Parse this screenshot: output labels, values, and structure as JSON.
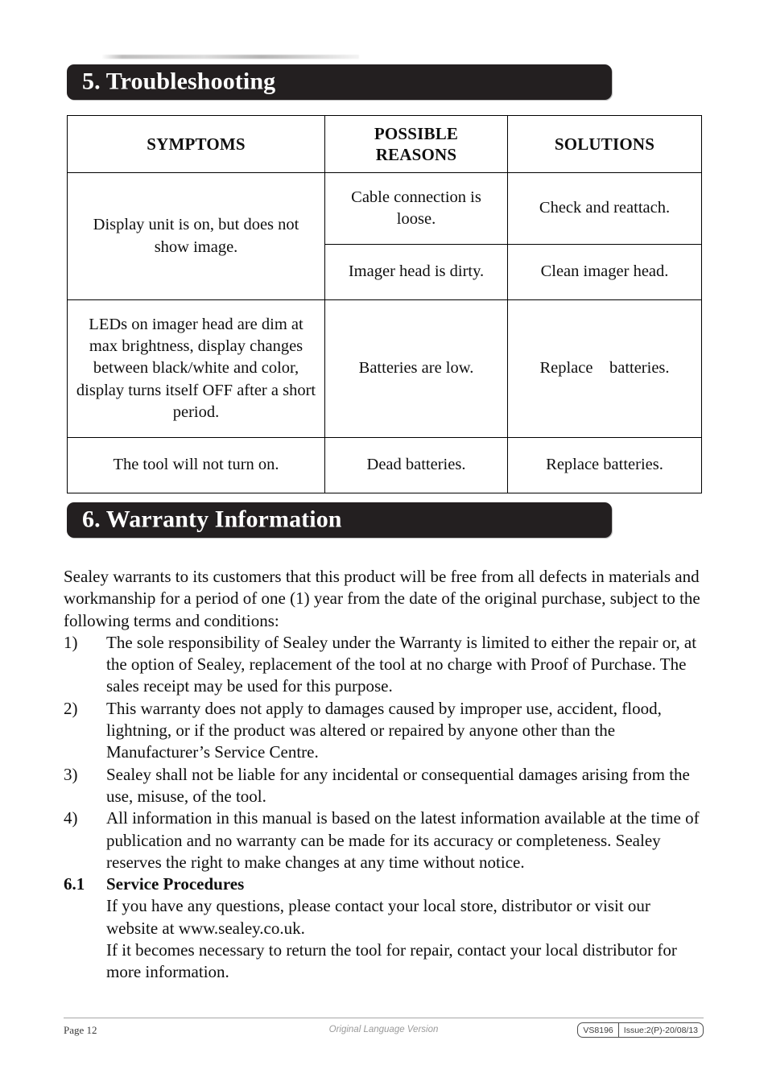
{
  "document": {
    "page_label": "Page 12",
    "footer_center_note": "Original Language Version",
    "footer_model": "VS8196",
    "footer_issue": "Issue:2(P)-20/08/13"
  },
  "sections": {
    "troubleshooting": {
      "heading": "5. Troubleshooting"
    },
    "warranty": {
      "heading": "6. Warranty Information"
    }
  },
  "troubleshooting_table": {
    "headers": {
      "symptoms": "SYMPTOMS",
      "possible_reasons": "POSSIBLE REASONS",
      "solutions": "SOLUTIONS"
    },
    "rows": [
      {
        "symptom": "Display unit is on, but does not show image.",
        "reason": "Cable connection is loose.",
        "solution": "Check and reattach."
      },
      {
        "symptom": "",
        "reason": "Imager head is dirty.",
        "solution": "Clean imager head."
      },
      {
        "symptom": "LEDs on imager head are dim at max brightness, display changes between black/white and color, display turns itself OFF after a short period.",
        "reason": "Batteries are low.",
        "solution": "Replace    batteries."
      },
      {
        "symptom": "The tool will not turn on.",
        "reason": "Dead batteries.",
        "solution": "Replace batteries."
      }
    ]
  },
  "warranty": {
    "intro": "Sealey warrants to its customers that this product will be free from all defects in materials and workmanship for a period of one (1) year from the date of the original purchase, subject to the following terms and conditions:",
    "items": [
      {
        "number": "1)",
        "text": "The sole responsibility of Sealey under the Warranty is limited to either the repair or, at the option of Sealey, replacement of the tool at no charge with Proof of Purchase. The sales receipt may be used for this purpose."
      },
      {
        "number": "2)",
        "text": "This warranty does not apply to damages caused by improper use, accident, flood, lightning, or if the product was altered or repaired by anyone other than the Manufacturer’s Service Centre."
      },
      {
        "number": "3)",
        "text": "Sealey shall not be liable for any incidental or consequential damages arising from the use, misuse, of the tool."
      },
      {
        "number": "4)",
        "text": "All information in this manual is based on the latest information available at the time of publication and no warranty can be made for its accuracy or completeness. Sealey reserves the right to make changes at any time without notice."
      }
    ],
    "service_procedures": {
      "number": "6.1",
      "heading": "Service Procedures",
      "paragraph_1": "If you have any questions, please contact your local store, distributor or visit our website at www.sealey.co.uk.",
      "paragraph_2": "If it becomes necessary to return the tool for repair, contact your local distributor for more information."
    }
  },
  "colors": {
    "bar_background": "#231f20",
    "bar_text": "#ffffff",
    "body_text": "#0f0f0f",
    "table_border": "#000000"
  }
}
